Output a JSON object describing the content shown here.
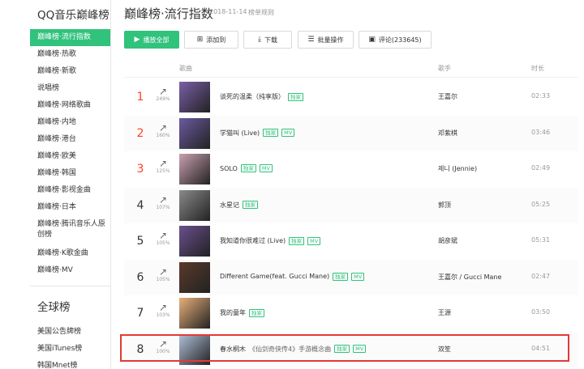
{
  "sidebar": {
    "title": "QQ音乐巅峰榜",
    "items": [
      {
        "label": "巅峰榜·流行指数",
        "active": true
      },
      {
        "label": "巅峰榜·热歌"
      },
      {
        "label": "巅峰榜·新歌"
      },
      {
        "label": "说唱榜"
      },
      {
        "label": "巅峰榜·网络歌曲"
      },
      {
        "label": "巅峰榜·内地"
      },
      {
        "label": "巅峰榜·港台"
      },
      {
        "label": "巅峰榜·欧美"
      },
      {
        "label": "巅峰榜·韩国"
      },
      {
        "label": "巅峰榜·影视金曲"
      },
      {
        "label": "巅峰榜·日本"
      },
      {
        "label": "巅峰榜·腾讯音乐人原创榜"
      },
      {
        "label": "巅峰榜·K歌金曲"
      },
      {
        "label": "巅峰榜·MV"
      }
    ],
    "global_title": "全球榜",
    "global_items": [
      {
        "label": "美国公告牌榜"
      },
      {
        "label": "美国iTunes榜"
      },
      {
        "label": "韩国Mnet榜"
      }
    ]
  },
  "header": {
    "title": "巅峰榜·流行指数",
    "date": "2018-11-14",
    "rule": "榜单规则"
  },
  "toolbar": {
    "play_all": "播放全部",
    "add_to": "添加到",
    "download": "下载",
    "batch": "批量操作",
    "comment": "评论(233645)"
  },
  "columns": {
    "song": "歌曲",
    "singer": "歌手",
    "duration": "时长"
  },
  "colors": {
    "accent": "#31c27c",
    "top_rank": "#ff4222",
    "highlight": "#e53935"
  },
  "rows": [
    {
      "rank": "1",
      "pct": "249%",
      "title": "谈死的温柔（纯享版）",
      "tags": [
        "独家"
      ],
      "singer": "王嘉尔",
      "duration": "02:33",
      "cover": "#7a5fa8"
    },
    {
      "rank": "2",
      "pct": "160%",
      "title": "学猫叫 (Live)",
      "tags": [
        "独家",
        "MV"
      ],
      "singer": "邓紫棋",
      "duration": "03:46",
      "cover": "#6b5aa0"
    },
    {
      "rank": "3",
      "pct": "125%",
      "title": "SOLO",
      "tags": [
        "独家",
        "MV"
      ],
      "singer": "제니 (Jennie)",
      "duration": "02:49",
      "cover": "#c9a0b0"
    },
    {
      "rank": "4",
      "pct": "107%",
      "title": "水星记",
      "tags": [
        "独家"
      ],
      "singer": "郭顶",
      "duration": "05:25",
      "cover": "#8a8a8a"
    },
    {
      "rank": "5",
      "pct": "105%",
      "title": "我知道你很难过 (Live)",
      "tags": [
        "独家",
        "MV"
      ],
      "singer": "胡彦斌",
      "duration": "05:31",
      "cover": "#6a4f8f"
    },
    {
      "rank": "6",
      "pct": "105%",
      "title": "Different Game(feat. Gucci Mane)",
      "tags": [
        "独家",
        "MV"
      ],
      "singer": "王嘉尔 / Gucci Mane",
      "duration": "02:47",
      "cover": "#5a3a2a"
    },
    {
      "rank": "7",
      "pct": "103%",
      "title": "我的童年",
      "tags": [
        "独家"
      ],
      "singer": "王源",
      "duration": "03:50",
      "cover": "#e8b07a"
    },
    {
      "rank": "8",
      "pct": "100%",
      "title": "春水桐木",
      "subtitle": "《仙剑奇侠传4》手游概念曲",
      "tags": [
        "独家",
        "MV"
      ],
      "singer": "双笙",
      "duration": "04:51",
      "cover": "#b0c0d8"
    }
  ]
}
